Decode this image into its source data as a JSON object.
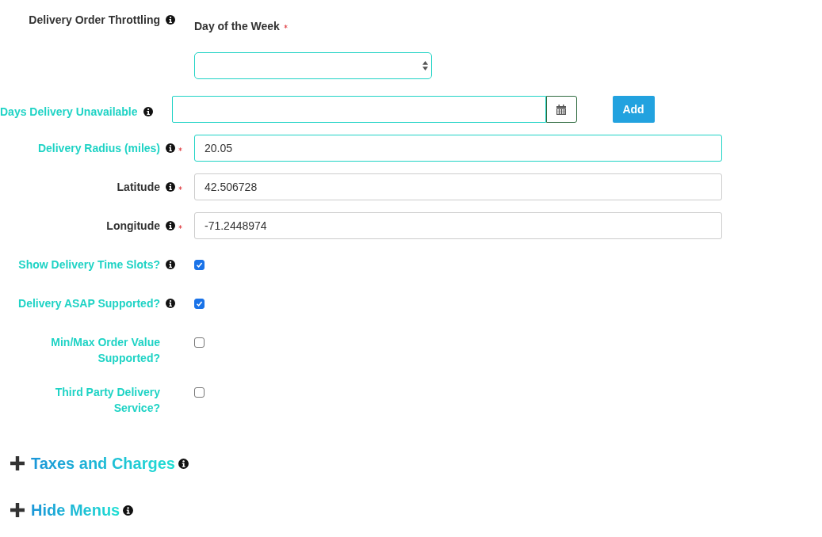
{
  "fields": [
    {
      "kind": "throttling",
      "label": "Delivery Order Throttling",
      "highlighted": false,
      "info": true,
      "required": false,
      "subfield": {
        "label": "Day of the Week",
        "required": true,
        "highlighted": true
      }
    },
    {
      "kind": "date",
      "label": "Days Delivery Unavailable",
      "highlighted": true,
      "info": true,
      "required": false,
      "button": "Add"
    },
    {
      "kind": "text",
      "label": "Delivery Radius (miles)",
      "highlighted": true,
      "info": true,
      "required": true,
      "value": "20.05"
    },
    {
      "kind": "text",
      "label": "Latitude",
      "highlighted": false,
      "info": true,
      "required": true,
      "value": "42.506728"
    },
    {
      "kind": "text",
      "label": "Longitude",
      "highlighted": false,
      "info": true,
      "required": true,
      "value": "-71.2448974"
    },
    {
      "kind": "checkbox",
      "label": "Show Delivery Time Slots?",
      "highlighted": true,
      "info": true,
      "required": false,
      "checked": true
    },
    {
      "kind": "checkbox",
      "label": "Delivery ASAP Supported?",
      "highlighted": true,
      "info": true,
      "required": false,
      "checked": true
    },
    {
      "kind": "checkbox",
      "label": "Min/Max Order Value Supported?",
      "highlighted": true,
      "info": false,
      "required": false,
      "checked": false
    },
    {
      "kind": "checkbox",
      "label": "Third Party Delivery Service?",
      "highlighted": true,
      "info": false,
      "required": false,
      "checked": false
    }
  ],
  "sections": [
    {
      "title": "Taxes and Charges",
      "expanded": false,
      "info": true
    },
    {
      "title": "Hide Menus",
      "expanded": false,
      "info": true
    }
  ]
}
